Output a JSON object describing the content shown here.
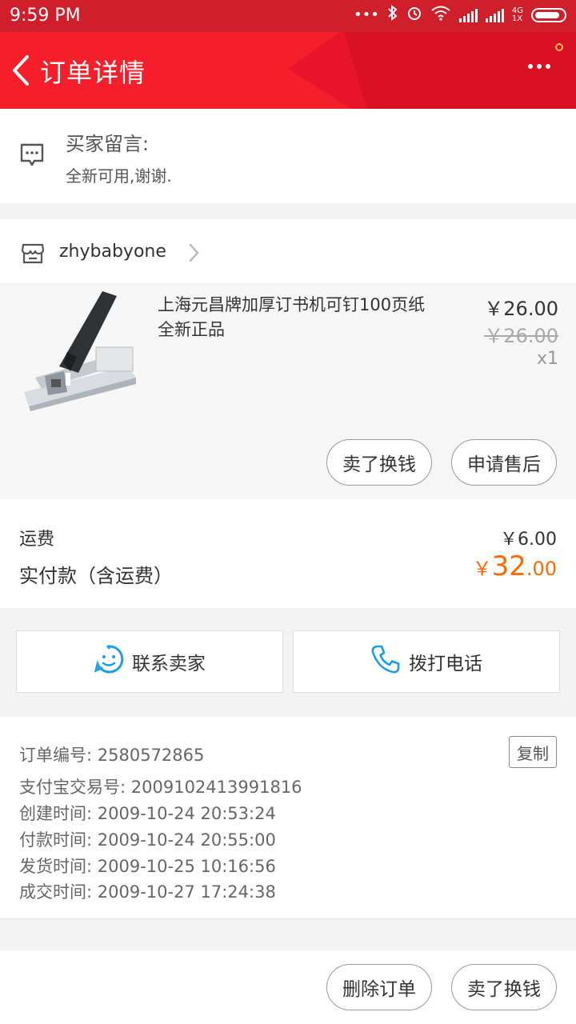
{
  "status_bar": {
    "time": "9:59 PM",
    "net_4g": "4G",
    "net_1x": "1X",
    "icons": [
      "dots-icon",
      "bluetooth-icon",
      "alarm-icon",
      "wifi-icon",
      "signal-icon",
      "signal-icon-2",
      "battery-icon"
    ]
  },
  "header": {
    "title": "订单详情",
    "accent": "#f41f2a"
  },
  "buyer_message": {
    "title": "买家留言:",
    "text": "全新可用,谢谢."
  },
  "shop": {
    "name": "zhybabyone"
  },
  "product": {
    "title": "上海元昌牌加厚订书机可钉100页纸 全新正品",
    "price": "￥26.00",
    "original_price": "￥26.00",
    "quantity": "x1",
    "actions": [
      "卖了换钱",
      "申请售后"
    ]
  },
  "summary": {
    "shipping_label": "运费",
    "shipping_value": "￥6.00",
    "paid_label": "实付款（含运费）",
    "paid_currency": "￥",
    "paid_integer": "32",
    "paid_decimal": ".00",
    "paid_color": "#ff6a00"
  },
  "contact": {
    "seller_label": "联系卖家",
    "call_label": "拨打电话",
    "icon_color": "#1e9ee6"
  },
  "order_info": {
    "copy_label": "复制",
    "rows": [
      {
        "label": "订单编号:",
        "value": "2580572865"
      },
      {
        "label": "支付宝交易号:",
        "value": "2009102413991816"
      },
      {
        "label": "创建时间:",
        "value": "2009-10-24 20:53:24"
      },
      {
        "label": "付款时间:",
        "value": "2009-10-24 20:55:00"
      },
      {
        "label": "发货时间:",
        "value": "2009-10-25 10:16:56"
      },
      {
        "label": "成交时间:",
        "value": "2009-10-27 17:24:38"
      }
    ]
  },
  "footer": {
    "delete_label": "删除订单",
    "sell_label": "卖了换钱"
  }
}
